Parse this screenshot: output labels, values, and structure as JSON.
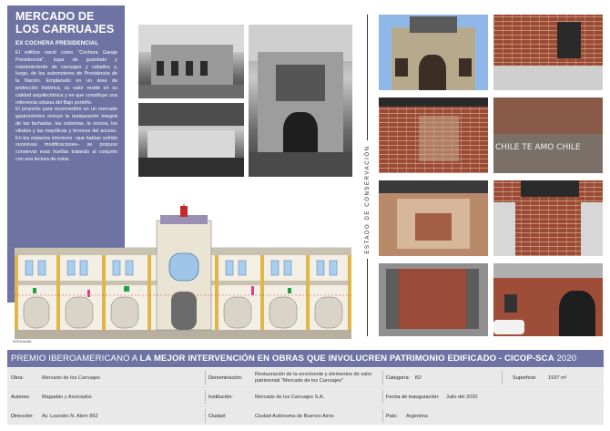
{
  "title_panel": {
    "title_line1": "MERCADO DE",
    "title_line2": "LOS CARRUAJES",
    "subtitle": "EX COCHERA PRESIDENCIAL",
    "paragraphs": [
      "El edificio nació como \"Cochera Garaje Presidencial\", lugar de guardado y mantenimiento de carruajes y caballos y, luego, de los automotores de Presidencia de la Nación. Emplazado en un área de protección histórica, su valor reside en su calidad arquitectónica y en que constituye una referencia urbana del Bajo porteño.",
      "El proyecto para reconvertirlo en un mercado gastronómico incluyó la restauración integral de las fachadas, las cubiertas, la recova, los vitrales y las mayólicas y bronces del acceso. En los espacios interiores –que habían sufrido sucesivas modificaciones– se propuso conservar esas huellas tratando al conjunto con una lectura de ruina."
    ]
  },
  "vertical_label": "ESTADO DE CONSERVACIÓN",
  "drawing_label": "VISTA ALMA",
  "photo_graffiti": "CHILE  TE AMO  CHILE",
  "banner": {
    "prefix": "PREMIO IBEROAMERICANO A ",
    "bold": "LA MEJOR INTERVENCIÓN EN OBRAS QUE INVOLUCREN PATRIMONIO EDIFICADO - CICOP-SCA",
    "year": " 2020"
  },
  "info": {
    "obra_label": "Obra:",
    "obra_value": "Mercado de los Carruajes",
    "denominacion_label": "Denominación:",
    "denominacion_value_1": "Restauración de la envolvente y elementos de valor",
    "denominacion_value_2": "patrimonial \"Mercado de los Carruajes\"",
    "categoria_label": "Categoría:",
    "categoria_value": "B2",
    "superficie_label": "Superficie:",
    "superficie_value": "1937 m²",
    "autores_label": "Autores:",
    "autores_value": "Magadán y Asociados",
    "institucion_label": "Institución:",
    "institucion_value": "Mercado de los Carruajes S.A.",
    "fecha_label": "Fecha de inauguración:",
    "fecha_value": "Julio del 2020",
    "direccion_label": "Dirección:",
    "direccion_value": "Av. Leandro N. Alem 852",
    "ciudad_label": "Ciudad:",
    "ciudad_value": "Ciudad Autónoma de Buenos Aires",
    "pais_label": "País:",
    "pais_value": "Argentina"
  }
}
